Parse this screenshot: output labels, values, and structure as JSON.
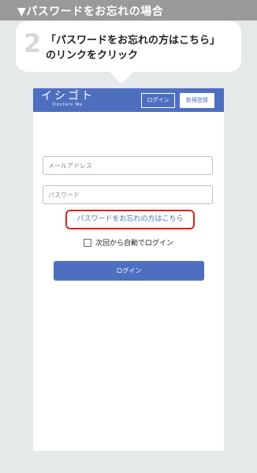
{
  "section": {
    "title": "▼パスワードをお忘れの場合"
  },
  "step": {
    "number": "2",
    "line1": "「パスワードをお忘れの方はこちら」",
    "line2": "のリンクをクリック"
  },
  "app": {
    "logo_main": "イシゴト",
    "logo_sub": "Doctors Me",
    "header_login": "ログイン",
    "header_signup": "新規登録",
    "email_placeholder": "メールアドレス",
    "password_placeholder": "パスワード",
    "forgot_link": "パスワードをお忘れの方はこちら",
    "remember_label": "次回から自動でログイン",
    "login_button": "ログイン"
  },
  "colors": {
    "brand": "#4e6fc0",
    "highlight": "#e02020",
    "band": "#9a9a9a",
    "background": "#e6e9ea"
  }
}
